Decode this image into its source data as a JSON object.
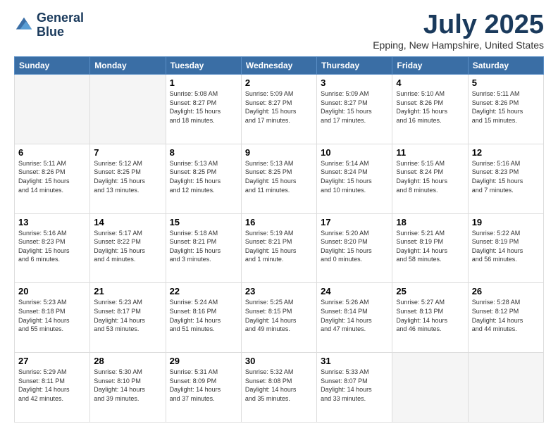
{
  "header": {
    "logo_line1": "General",
    "logo_line2": "Blue",
    "month_title": "July 2025",
    "location": "Epping, New Hampshire, United States"
  },
  "weekdays": [
    "Sunday",
    "Monday",
    "Tuesday",
    "Wednesday",
    "Thursday",
    "Friday",
    "Saturday"
  ],
  "weeks": [
    [
      {
        "day": "",
        "detail": ""
      },
      {
        "day": "",
        "detail": ""
      },
      {
        "day": "1",
        "detail": "Sunrise: 5:08 AM\nSunset: 8:27 PM\nDaylight: 15 hours\nand 18 minutes."
      },
      {
        "day": "2",
        "detail": "Sunrise: 5:09 AM\nSunset: 8:27 PM\nDaylight: 15 hours\nand 17 minutes."
      },
      {
        "day": "3",
        "detail": "Sunrise: 5:09 AM\nSunset: 8:27 PM\nDaylight: 15 hours\nand 17 minutes."
      },
      {
        "day": "4",
        "detail": "Sunrise: 5:10 AM\nSunset: 8:26 PM\nDaylight: 15 hours\nand 16 minutes."
      },
      {
        "day": "5",
        "detail": "Sunrise: 5:11 AM\nSunset: 8:26 PM\nDaylight: 15 hours\nand 15 minutes."
      }
    ],
    [
      {
        "day": "6",
        "detail": "Sunrise: 5:11 AM\nSunset: 8:26 PM\nDaylight: 15 hours\nand 14 minutes."
      },
      {
        "day": "7",
        "detail": "Sunrise: 5:12 AM\nSunset: 8:25 PM\nDaylight: 15 hours\nand 13 minutes."
      },
      {
        "day": "8",
        "detail": "Sunrise: 5:13 AM\nSunset: 8:25 PM\nDaylight: 15 hours\nand 12 minutes."
      },
      {
        "day": "9",
        "detail": "Sunrise: 5:13 AM\nSunset: 8:25 PM\nDaylight: 15 hours\nand 11 minutes."
      },
      {
        "day": "10",
        "detail": "Sunrise: 5:14 AM\nSunset: 8:24 PM\nDaylight: 15 hours\nand 10 minutes."
      },
      {
        "day": "11",
        "detail": "Sunrise: 5:15 AM\nSunset: 8:24 PM\nDaylight: 15 hours\nand 8 minutes."
      },
      {
        "day": "12",
        "detail": "Sunrise: 5:16 AM\nSunset: 8:23 PM\nDaylight: 15 hours\nand 7 minutes."
      }
    ],
    [
      {
        "day": "13",
        "detail": "Sunrise: 5:16 AM\nSunset: 8:23 PM\nDaylight: 15 hours\nand 6 minutes."
      },
      {
        "day": "14",
        "detail": "Sunrise: 5:17 AM\nSunset: 8:22 PM\nDaylight: 15 hours\nand 4 minutes."
      },
      {
        "day": "15",
        "detail": "Sunrise: 5:18 AM\nSunset: 8:21 PM\nDaylight: 15 hours\nand 3 minutes."
      },
      {
        "day": "16",
        "detail": "Sunrise: 5:19 AM\nSunset: 8:21 PM\nDaylight: 15 hours\nand 1 minute."
      },
      {
        "day": "17",
        "detail": "Sunrise: 5:20 AM\nSunset: 8:20 PM\nDaylight: 15 hours\nand 0 minutes."
      },
      {
        "day": "18",
        "detail": "Sunrise: 5:21 AM\nSunset: 8:19 PM\nDaylight: 14 hours\nand 58 minutes."
      },
      {
        "day": "19",
        "detail": "Sunrise: 5:22 AM\nSunset: 8:19 PM\nDaylight: 14 hours\nand 56 minutes."
      }
    ],
    [
      {
        "day": "20",
        "detail": "Sunrise: 5:23 AM\nSunset: 8:18 PM\nDaylight: 14 hours\nand 55 minutes."
      },
      {
        "day": "21",
        "detail": "Sunrise: 5:23 AM\nSunset: 8:17 PM\nDaylight: 14 hours\nand 53 minutes."
      },
      {
        "day": "22",
        "detail": "Sunrise: 5:24 AM\nSunset: 8:16 PM\nDaylight: 14 hours\nand 51 minutes."
      },
      {
        "day": "23",
        "detail": "Sunrise: 5:25 AM\nSunset: 8:15 PM\nDaylight: 14 hours\nand 49 minutes."
      },
      {
        "day": "24",
        "detail": "Sunrise: 5:26 AM\nSunset: 8:14 PM\nDaylight: 14 hours\nand 47 minutes."
      },
      {
        "day": "25",
        "detail": "Sunrise: 5:27 AM\nSunset: 8:13 PM\nDaylight: 14 hours\nand 46 minutes."
      },
      {
        "day": "26",
        "detail": "Sunrise: 5:28 AM\nSunset: 8:12 PM\nDaylight: 14 hours\nand 44 minutes."
      }
    ],
    [
      {
        "day": "27",
        "detail": "Sunrise: 5:29 AM\nSunset: 8:11 PM\nDaylight: 14 hours\nand 42 minutes."
      },
      {
        "day": "28",
        "detail": "Sunrise: 5:30 AM\nSunset: 8:10 PM\nDaylight: 14 hours\nand 39 minutes."
      },
      {
        "day": "29",
        "detail": "Sunrise: 5:31 AM\nSunset: 8:09 PM\nDaylight: 14 hours\nand 37 minutes."
      },
      {
        "day": "30",
        "detail": "Sunrise: 5:32 AM\nSunset: 8:08 PM\nDaylight: 14 hours\nand 35 minutes."
      },
      {
        "day": "31",
        "detail": "Sunrise: 5:33 AM\nSunset: 8:07 PM\nDaylight: 14 hours\nand 33 minutes."
      },
      {
        "day": "",
        "detail": ""
      },
      {
        "day": "",
        "detail": ""
      }
    ]
  ]
}
